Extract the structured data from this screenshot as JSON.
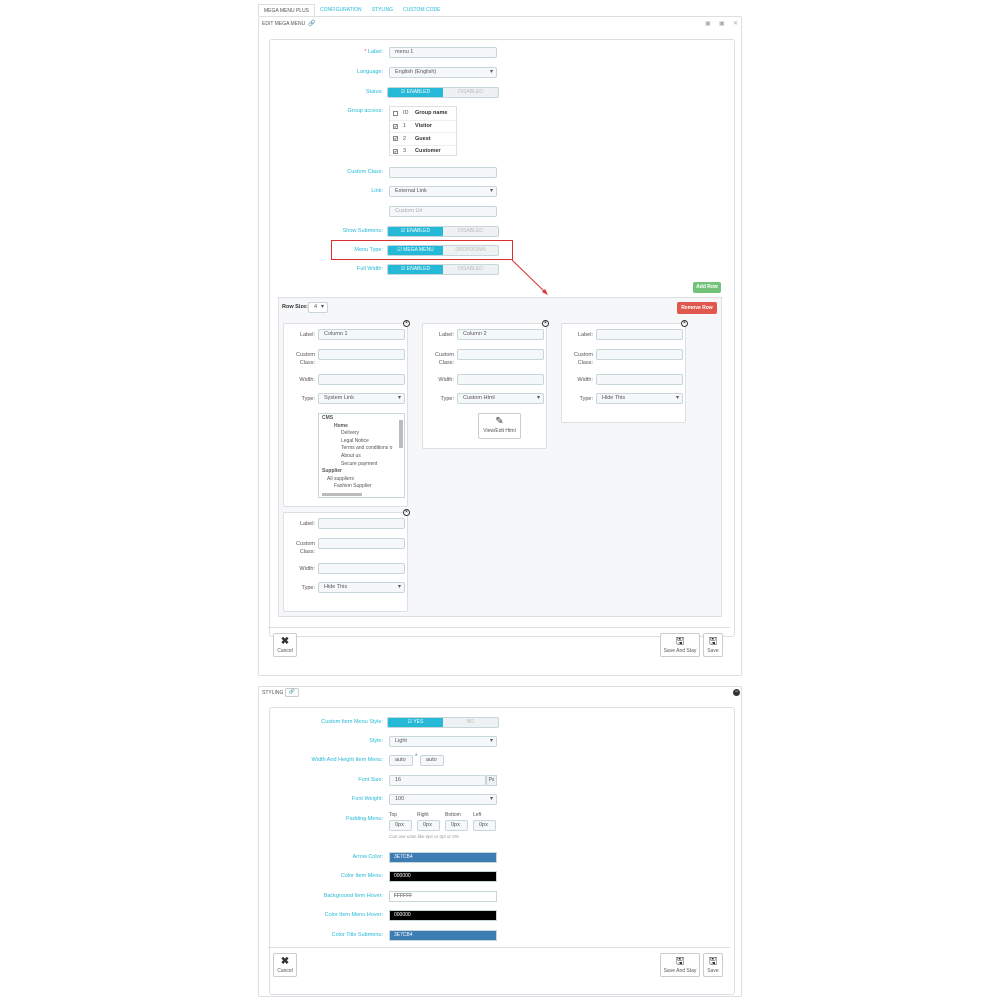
{
  "tabs": [
    "MEGA MENU PLUS",
    "CONFIGURATION",
    "STYLING",
    "CUSTOM CODE"
  ],
  "edit_panel": {
    "title": "EDIT MEGA MENU"
  },
  "form": {
    "label": {
      "label": "Label:",
      "required_mark": "*",
      "value": "menu 1"
    },
    "language": {
      "label": "Language:",
      "value": "English (English)"
    },
    "status": {
      "label": "Status:",
      "on": "ENABLED",
      "off": "DISABLED"
    },
    "group_access": {
      "label": "Group access:",
      "headers": [
        "ID",
        "Group name"
      ],
      "rows": [
        {
          "id": "1",
          "name": "Visitor"
        },
        {
          "id": "2",
          "name": "Guest"
        },
        {
          "id": "3",
          "name": "Customer"
        }
      ]
    },
    "custom_class": {
      "label": "Custom Class:"
    },
    "link": {
      "label": "Link:",
      "value": "External Link",
      "url_placeholder": "Custom Url"
    },
    "show_submenu": {
      "label": "Show Submenu:",
      "on": "ENABLED",
      "off": "DISABLED"
    },
    "menu_type": {
      "label": "Menu Type:",
      "on": "MEGA MENU",
      "off": "DROPDOWN"
    },
    "full_width": {
      "label": "Full Width:",
      "on": "ENABLED",
      "off": "DISABLED"
    }
  },
  "rows": {
    "add_row": "Add Row",
    "remove_row": "Remove Row",
    "row_size_label": "Row Size:",
    "row_size_value": "4"
  },
  "columns": [
    {
      "label_label": "Label:",
      "label_value": "Column 1",
      "class_label": "Custom Class:",
      "width_label": "Width:",
      "type_label": "Type:",
      "type_value": "System Link"
    },
    {
      "label_label": "Label:",
      "label_value": "Column 2",
      "class_label": "Custom Class:",
      "width_label": "Width:",
      "type_label": "Type:",
      "type_value": "Custom Html",
      "view_html": "View/Edit Html"
    },
    {
      "label_label": "Label:",
      "label_value": "",
      "class_label": "Custom Class:",
      "width_label": "Width:",
      "type_label": "Type:",
      "type_value": "Hide This"
    },
    {
      "label_label": "Label:",
      "label_value": "",
      "class_label": "Custom Class:",
      "width_label": "Width:",
      "type_label": "Type:",
      "type_value": "Hide This"
    }
  ],
  "tree": {
    "items": [
      "CMS",
      "Home",
      "Delivery",
      "Legal Notice",
      "Terms and conditions o",
      "About us",
      "Secure payment",
      "Supplier",
      "All suppliers",
      "Fashion Supplier"
    ]
  },
  "footer": {
    "cancel": "Cancel",
    "save_stay": "Save And Stay",
    "save": "Save"
  },
  "styling": {
    "title": "STYLING",
    "custom_style": {
      "label": "Custom Item Menu Style:",
      "on": "YES",
      "off": "NO"
    },
    "style": {
      "label": "Style:",
      "value": "Light"
    },
    "width_height": {
      "label": "Width And Height Item Menu:",
      "w": "auto",
      "x": "*",
      "h": "auto"
    },
    "font_size": {
      "label": "Font Size:",
      "value": "16",
      "unit": "Px"
    },
    "font_weight": {
      "label": "Font Weight:",
      "value": "100"
    },
    "padding": {
      "label": "Padding Menu:",
      "sides": [
        "Top",
        "Right",
        "Bottom",
        "Left"
      ],
      "values": [
        "0px",
        "0px",
        "0px",
        "0px"
      ],
      "hint": "Can use units like 0px or 0pt or 0%"
    },
    "colors": [
      {
        "label": "Arrow Color:",
        "value": "3E7CB4",
        "color": "#3E7CB4",
        "text": "#ffffff"
      },
      {
        "label": "Color Item Menu:",
        "value": "000000",
        "color": "#000000",
        "text": "#ffffff"
      },
      {
        "label": "Background Item Hover:",
        "value": "FFFFFF",
        "color": "#FFFFFF",
        "text": "#333333"
      },
      {
        "label": "Color Item Menu Hover:",
        "value": "000000",
        "color": "#000000",
        "text": "#ffffff"
      },
      {
        "label": "Color Title Submenu:",
        "value": "3E7CB4",
        "color": "#3E7CB4",
        "text": "#ffffff"
      }
    ]
  }
}
